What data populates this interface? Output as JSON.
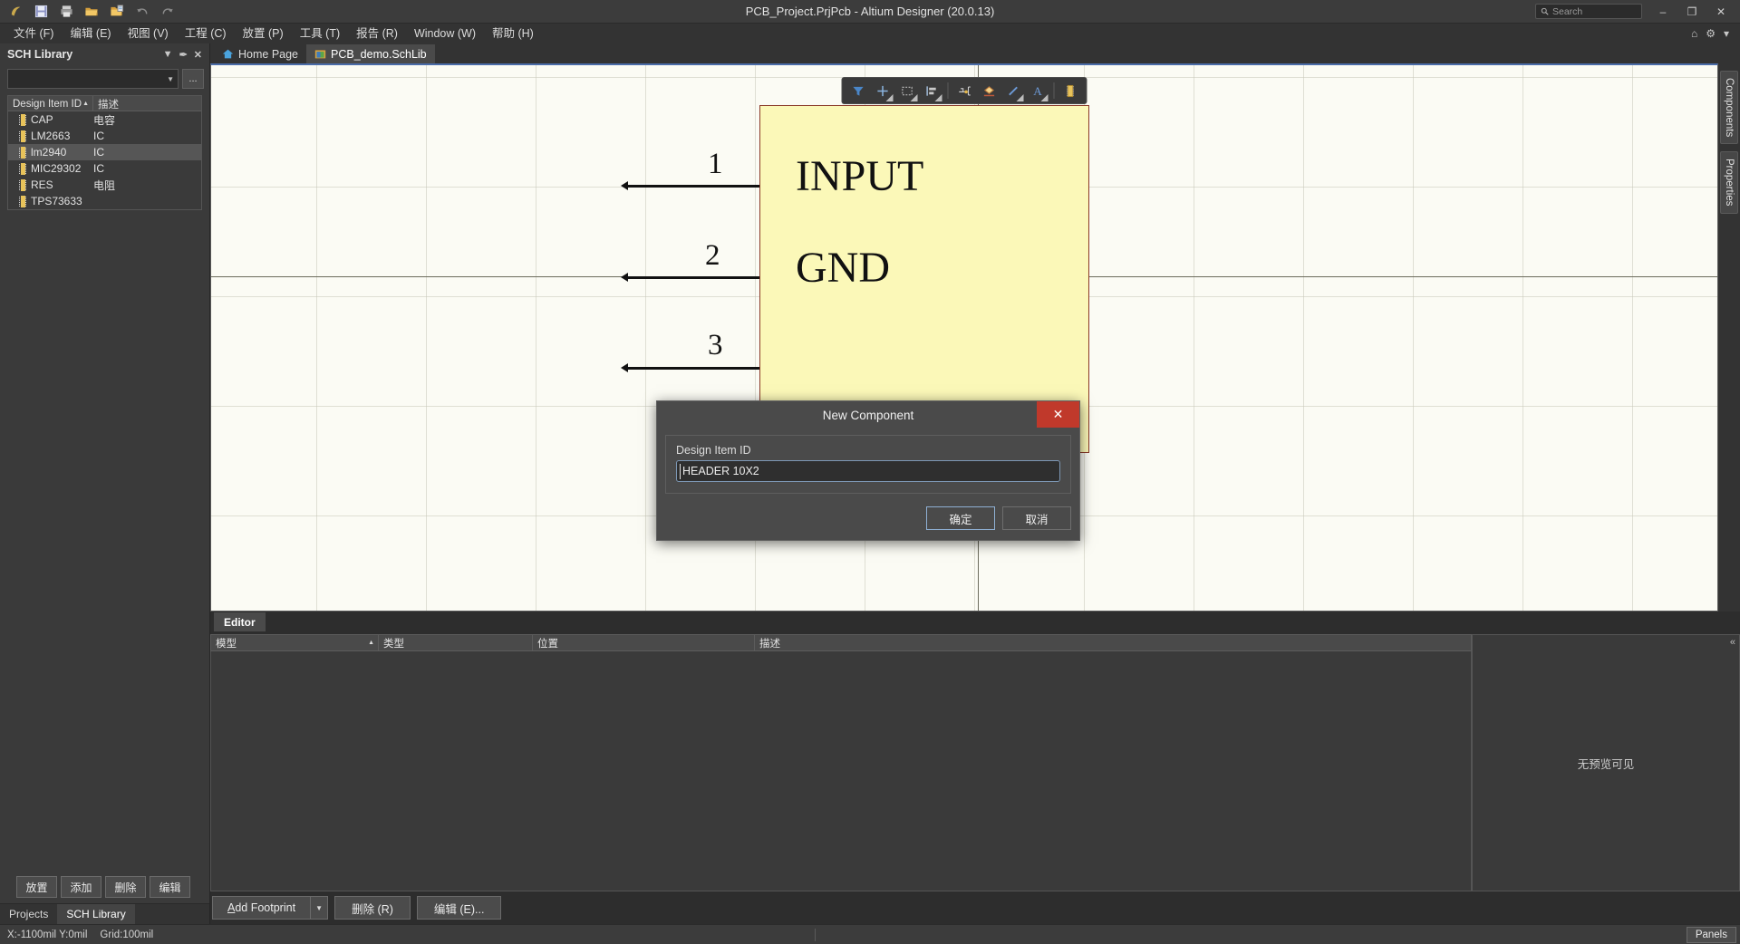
{
  "titlebar": {
    "title": "PCB_Project.PrjPcb - Altium Designer (20.0.13)",
    "quick_access": [
      {
        "name": "altium-logo-icon",
        "label": "Altium"
      },
      {
        "name": "save-icon",
        "label": "Save"
      },
      {
        "name": "print-icon",
        "label": "Print"
      },
      {
        "name": "open-folder-icon",
        "label": "Open"
      },
      {
        "name": "open-project-icon",
        "label": "Open Project"
      },
      {
        "name": "undo-icon",
        "label": "Undo"
      },
      {
        "name": "redo-icon",
        "label": "Redo"
      }
    ],
    "search_placeholder": "Search",
    "window_buttons": {
      "minimize": "–",
      "maximize": "❐",
      "close": "✕"
    }
  },
  "menubar": {
    "items": [
      {
        "label": "文件 (F)",
        "name": "menu-file"
      },
      {
        "label": "编辑 (E)",
        "name": "menu-edit"
      },
      {
        "label": "视图 (V)",
        "name": "menu-view"
      },
      {
        "label": "工程 (C)",
        "name": "menu-project"
      },
      {
        "label": "放置 (P)",
        "name": "menu-place"
      },
      {
        "label": "工具 (T)",
        "name": "menu-tools"
      },
      {
        "label": "报告 (R)",
        "name": "menu-reports"
      },
      {
        "label": "Window (W)",
        "name": "menu-window"
      },
      {
        "label": "帮助 (H)",
        "name": "menu-help"
      }
    ],
    "right_icons": [
      {
        "name": "home-icon",
        "glyph": "⌂"
      },
      {
        "name": "gear-icon",
        "glyph": "⚙"
      },
      {
        "name": "user-account-icon",
        "glyph": "▾"
      }
    ]
  },
  "sidebar": {
    "title": "SCH Library",
    "header_controls": [
      {
        "name": "panel-dropdown-icon",
        "glyph": "▼"
      },
      {
        "name": "panel-pin-icon",
        "glyph": "✒"
      },
      {
        "name": "panel-close-icon",
        "glyph": "✕"
      }
    ],
    "filter_value": "",
    "browse_button": "...",
    "columns": [
      "Design Item ID",
      "描述"
    ],
    "components": [
      {
        "id": "CAP",
        "desc": "电容",
        "selected": false
      },
      {
        "id": "LM2663",
        "desc": "IC",
        "selected": false
      },
      {
        "id": "lm2940",
        "desc": "IC",
        "selected": true
      },
      {
        "id": "MIC29302",
        "desc": "IC",
        "selected": false
      },
      {
        "id": "RES",
        "desc": "电阻",
        "selected": false
      },
      {
        "id": "TPS73633",
        "desc": "",
        "selected": false
      }
    ],
    "buttons": [
      {
        "label": "放置",
        "name": "place-button"
      },
      {
        "label": "添加",
        "name": "add-button"
      },
      {
        "label": "删除",
        "name": "delete-button"
      },
      {
        "label": "编辑",
        "name": "edit-button"
      }
    ],
    "tabs": [
      {
        "label": "Projects",
        "name": "tab-projects",
        "active": false
      },
      {
        "label": "SCH Library",
        "name": "tab-sch-library",
        "active": true
      }
    ]
  },
  "doc_tabs": [
    {
      "label": "Home Page",
      "name": "doc-tab-home-page",
      "active": false,
      "icon": "home-icon"
    },
    {
      "label": "PCB_demo.SchLib",
      "name": "doc-tab-schlib",
      "active": true,
      "icon": "schlib-icon"
    }
  ],
  "sch_toolbar": [
    {
      "name": "filter-icon",
      "glyph": "filter"
    },
    {
      "name": "place-part-icon",
      "glyph": "cross"
    },
    {
      "name": "rectangle-icon",
      "glyph": "rect"
    },
    {
      "name": "align-icon",
      "glyph": "align"
    },
    {
      "name": "place-pin-icon",
      "glyph": "pin"
    },
    {
      "name": "place-polygon-icon",
      "glyph": "poly"
    },
    {
      "name": "place-line-icon",
      "glyph": "line"
    },
    {
      "name": "place-text-icon",
      "glyph": "text"
    },
    {
      "name": "place-component-icon",
      "glyph": "comp"
    }
  ],
  "schematic": {
    "body_labels": [
      {
        "text": "INPUT",
        "name": "sch-label-input"
      },
      {
        "text": "GND",
        "name": "sch-label-gnd"
      }
    ],
    "pins": [
      {
        "number": "1",
        "name": "sch-pin-1"
      },
      {
        "number": "2",
        "name": "sch-pin-2"
      },
      {
        "number": "3",
        "name": "sch-pin-3"
      }
    ]
  },
  "model_panel": {
    "tab": "Editor",
    "columns": [
      "模型",
      "类型",
      "位置",
      "描述"
    ],
    "rows": [],
    "preview_text": "无预览可见",
    "buttons": [
      {
        "label": "Add Footprint",
        "name": "add-footprint-button",
        "accel": "A"
      },
      {
        "label": "删除 (R)",
        "name": "delete-model-button"
      },
      {
        "label": "编辑 (E)...",
        "name": "edit-model-button"
      }
    ],
    "dropdown_glyph": "▼"
  },
  "right_dock": [
    {
      "label": "Components",
      "name": "dock-tab-components"
    },
    {
      "label": "Properties",
      "name": "dock-tab-properties"
    }
  ],
  "statusbar": {
    "coordinates": "X:-1100mil Y:0mil",
    "grid": "Grid:100mil",
    "panels_button": "Panels"
  },
  "dialog": {
    "title": "New Component",
    "close_glyph": "✕",
    "field_label": "Design Item ID",
    "field_value": "HEADER 10X2",
    "ok_button": "确定",
    "cancel_button": "取消"
  },
  "colors": {
    "accent": "#4a6ca8",
    "danger": "#c0392b",
    "canvas": "#fbfbf4",
    "component_fill": "#fbf8b8",
    "component_border": "#8a3a28",
    "selection": "#565656"
  }
}
